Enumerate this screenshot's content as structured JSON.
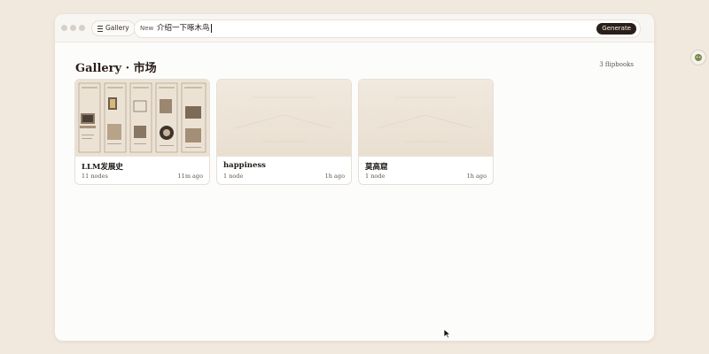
{
  "topbar": {
    "gallery_label": "Gallery",
    "new_label": "New",
    "prompt_value": "介绍一下啄木鸟",
    "generate_label": "Generate"
  },
  "page": {
    "title": "Gallery · 市场",
    "count": "3 flipbooks"
  },
  "cards": [
    {
      "title": "LLM发展史",
      "nodes": "11 nodes",
      "time": "11m ago",
      "thumb": "illustration"
    },
    {
      "title": "happiness",
      "nodes": "1 node",
      "time": "1h ago",
      "thumb": "placeholder"
    },
    {
      "title": "莫高窟",
      "nodes": "1 node",
      "time": "1h ago",
      "thumb": "placeholder"
    }
  ],
  "colors": {
    "background": "#f1e8de",
    "window": "#fcfcfb",
    "accent_button": "#2a1f18",
    "card_border": "#e6dfd6"
  },
  "icons": [
    "menu-icon",
    "side-widget-icon",
    "cursor-arrow"
  ]
}
